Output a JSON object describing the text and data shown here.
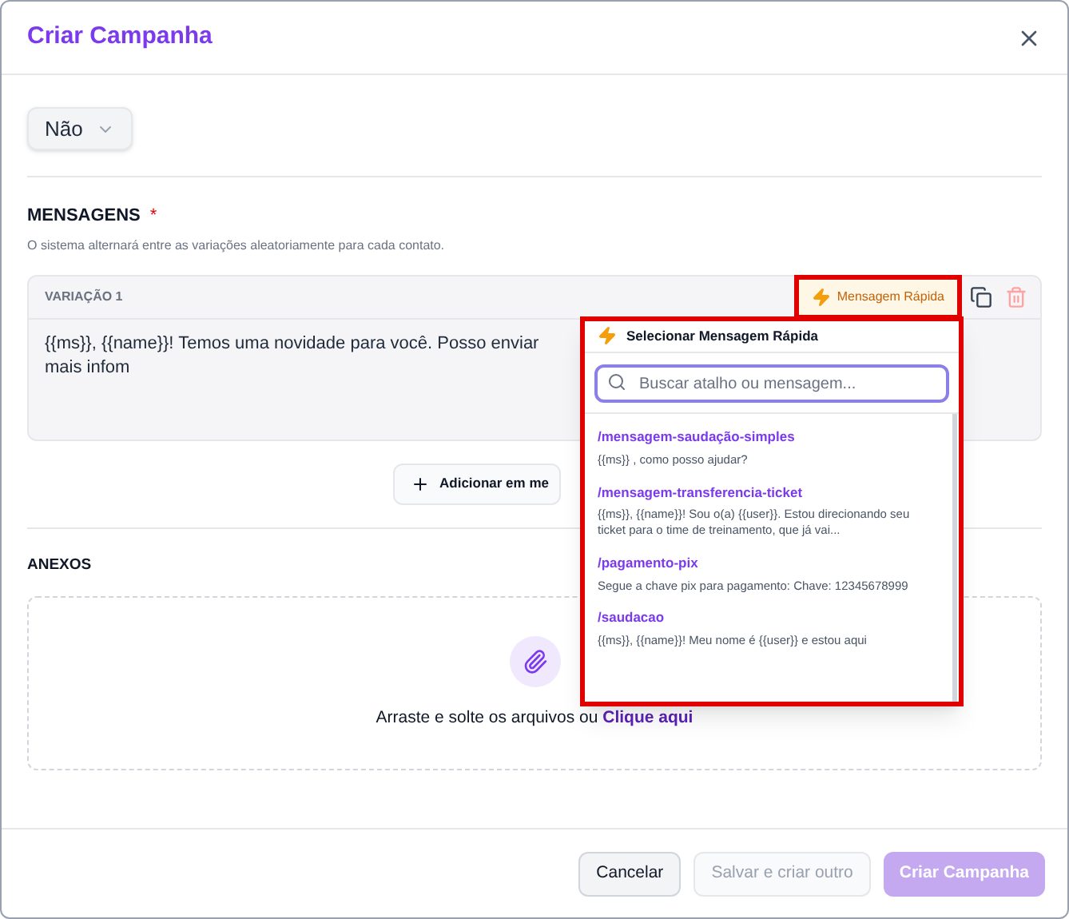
{
  "dialog": {
    "title": "Criar Campanha"
  },
  "previous_field": {
    "value": "Não"
  },
  "messages": {
    "title": "MENSAGENS",
    "required": "*",
    "hint": "O sistema alternará entre as variações aleatoriamente para cada contato.",
    "quick_message_button": "Mensagem Rápida",
    "add_button": "Adicionar em me",
    "variations": [
      {
        "label": "VARIAÇÃO 1",
        "text": "{{ms}}, {{name}}! Temos uma novidade para você. Posso enviar mais infom"
      }
    ]
  },
  "quick_menu": {
    "title": "Selecionar Mensagem Rápida",
    "search": {
      "placeholder": "Buscar atalho ou mensagem..."
    },
    "items": [
      {
        "shortcut": "/mensagem-saudação-simples",
        "text": "{{ms}} , como posso ajudar?"
      },
      {
        "shortcut": "/mensagem-transferencia-ticket",
        "text": "{{ms}}, {{name}}! Sou o(a) {{user}}. Estou direcionando seu ticket para o time de treinamento, que já vai..."
      },
      {
        "shortcut": "/pagamento-pix",
        "text": "Segue a chave pix para pagamento: Chave: 12345678999"
      },
      {
        "shortcut": "/saudacao",
        "text": "{{ms}}, {{name}}! Meu nome é {{user}} e estou aqui"
      }
    ]
  },
  "attachments": {
    "title": "ANEXOS",
    "prompt": "Arraste e solte os arquivos ou",
    "link": "Clique aqui"
  },
  "footer": {
    "buttons": [
      {
        "label": "Cancelar",
        "kind": "secondary"
      },
      {
        "label": "Salvar e criar outro",
        "kind": "disabled"
      },
      {
        "label": "Criar Campanha",
        "kind": "primary_disabled"
      }
    ]
  }
}
